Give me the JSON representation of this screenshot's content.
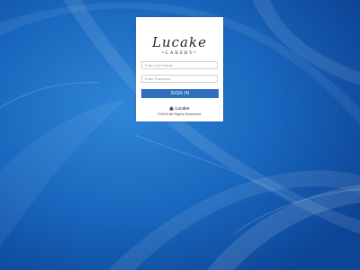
{
  "colors": {
    "background": "#1a63b5",
    "button": "#2f6fbf",
    "card": "#ffffff"
  },
  "logo": {
    "script_text": "Lucake",
    "sub_text": "•CAKERY•"
  },
  "form": {
    "username_placeholder": "Enter User Name",
    "password_placeholder": "Enter Password",
    "signin_label": "SIGN IN"
  },
  "footer": {
    "brand_icon": "lucake-logo-icon",
    "brand_name": "Lucake",
    "copyright": "©2019 All Rights Reserved."
  }
}
